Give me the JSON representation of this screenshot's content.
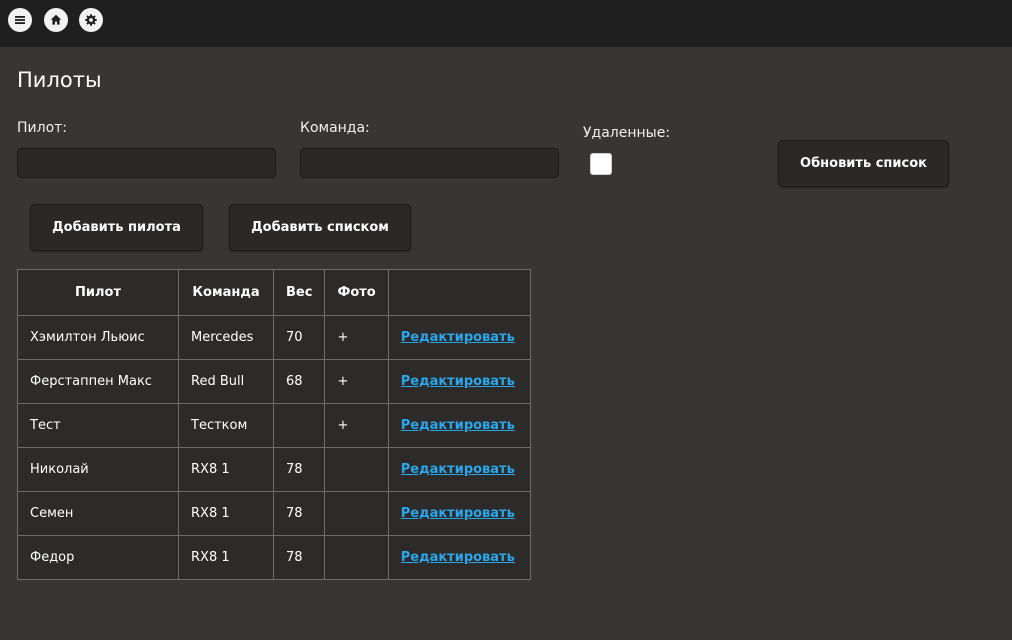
{
  "topbar": {
    "buttons": [
      {
        "icon": "menu-icon"
      },
      {
        "icon": "home-icon"
      },
      {
        "icon": "gear-icon"
      }
    ]
  },
  "page": {
    "title": "Пилоты"
  },
  "filters": {
    "pilot_label": "Пилот:",
    "pilot_value": "",
    "team_label": "Команда:",
    "team_value": "",
    "deleted_label": "Удаленные:",
    "deleted_checked": false,
    "refresh_label": "Обновить список"
  },
  "actions": {
    "add_pilot_label": "Добавить пилота",
    "add_list_label": "Добавить списком"
  },
  "table": {
    "headers": [
      "Пилот",
      "Команда",
      "Вес",
      "Фото",
      ""
    ],
    "rows": [
      {
        "pilot": "Хэмилтон Льюис",
        "team": "Mercedes",
        "weight": "70",
        "photo": "+",
        "edit": "Редактировать"
      },
      {
        "pilot": "Ферстаппен Макс",
        "team": "Red Bull",
        "weight": "68",
        "photo": "+",
        "edit": "Редактировать"
      },
      {
        "pilot": "Тест",
        "team": "Тестком",
        "weight": "",
        "photo": "+",
        "edit": "Редактировать"
      },
      {
        "pilot": "Николай",
        "team": "RX8 1",
        "weight": "78",
        "photo": "",
        "edit": "Редактировать"
      },
      {
        "pilot": "Семен",
        "team": "RX8 1",
        "weight": "78",
        "photo": "",
        "edit": "Редактировать"
      },
      {
        "pilot": "Федор",
        "team": "RX8 1",
        "weight": "78",
        "photo": "",
        "edit": "Редактировать"
      }
    ]
  },
  "colors": {
    "background": "#383633",
    "topbar": "#1f1f1f",
    "link": "#2aa6ea"
  }
}
